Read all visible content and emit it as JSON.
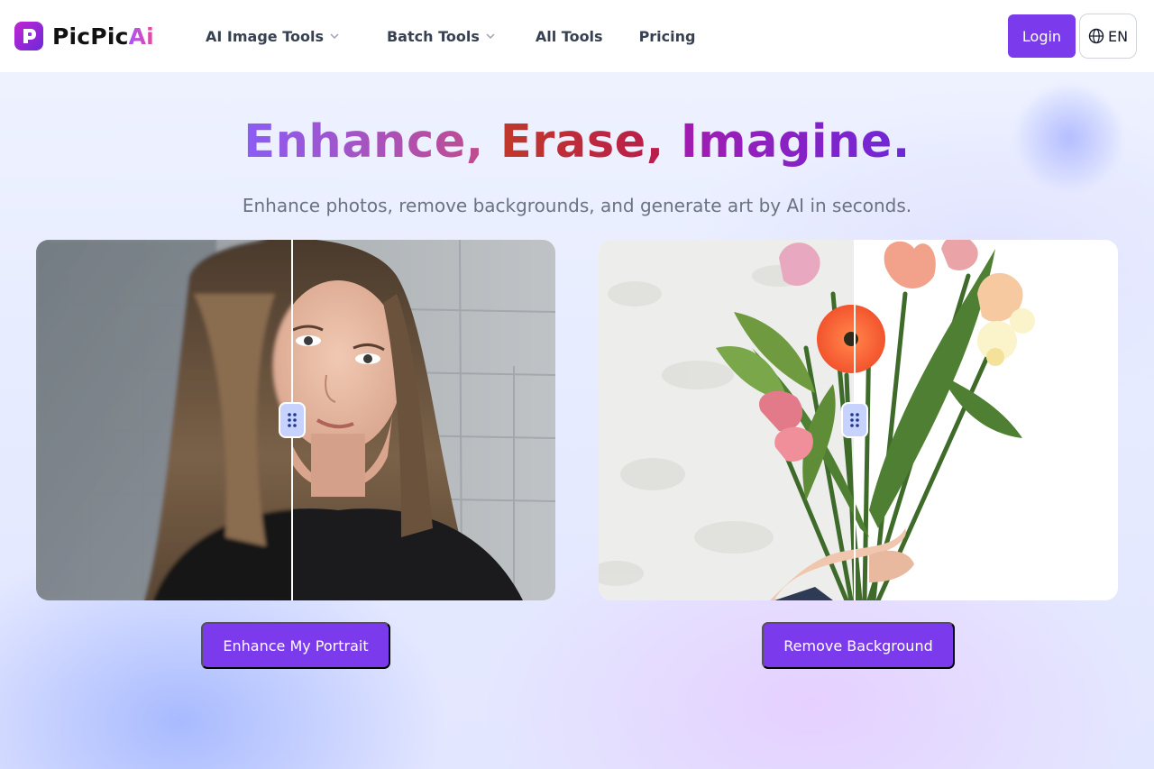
{
  "brand": {
    "name_part1": "PicPic",
    "name_part2": "Ai"
  },
  "nav": {
    "items": [
      {
        "label": "AI Image Tools",
        "has_dropdown": true
      },
      {
        "label": "Batch Tools",
        "has_dropdown": true
      },
      {
        "label": "All Tools",
        "has_dropdown": false
      },
      {
        "label": "Pricing",
        "has_dropdown": false
      }
    ]
  },
  "header": {
    "login_label": "Login",
    "language": "EN",
    "language_icon": "globe-icon"
  },
  "hero": {
    "title_word1": "Enhance,",
    "title_word2": "Erase,",
    "title_word3": "Imagine.",
    "subtitle": "Enhance photos, remove backgrounds, and generate art by AI in seconds."
  },
  "compare": {
    "left": {
      "subject": "portrait of woman, blurry before / sharp after",
      "slider_position": 0.49,
      "cta_label": "Enhance My Portrait"
    },
    "right": {
      "subject": "flower bouquet in hand, background on left / removed on right",
      "slider_position": 0.49,
      "cta_label": "Remove Background"
    }
  },
  "colors": {
    "accent": "#7c3aed",
    "handle": "#c7d2fe"
  }
}
